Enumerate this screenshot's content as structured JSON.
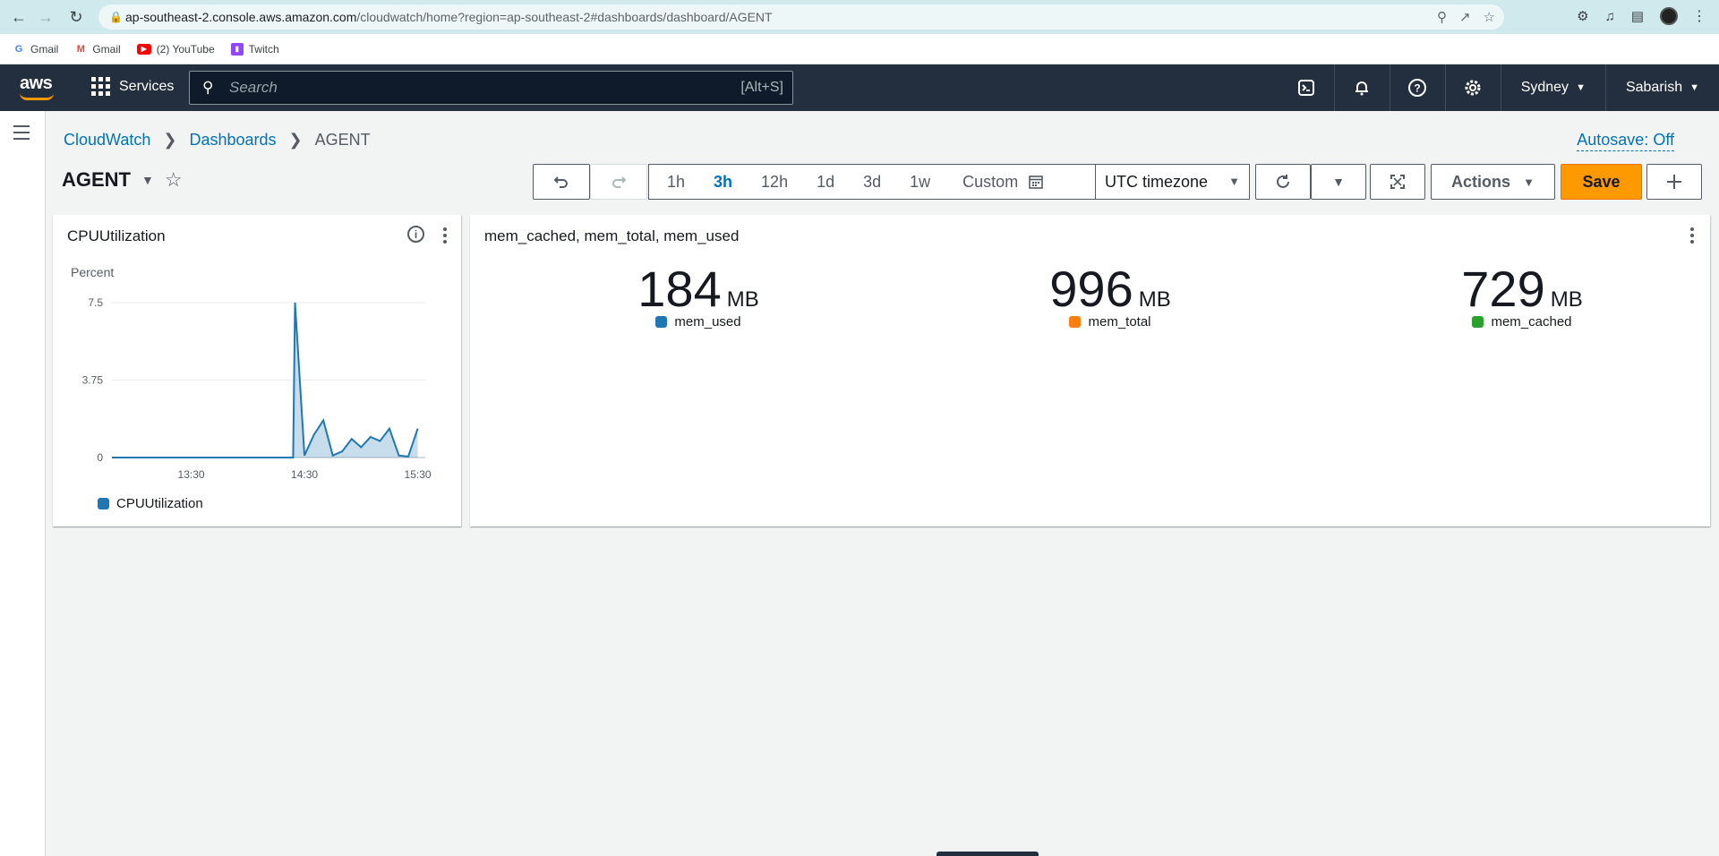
{
  "browser": {
    "url_host": "ap-southeast-2.console.aws.amazon.com",
    "url_path": "/cloudwatch/home?region=ap-southeast-2#dashboards/dashboard/AGENT",
    "bookmarks": [
      {
        "label": "Gmail",
        "icon": "google-icon"
      },
      {
        "label": "Gmail",
        "icon": "gmail-icon"
      },
      {
        "label": "(2) YouTube",
        "icon": "youtube-icon"
      },
      {
        "label": "Twitch",
        "icon": "twitch-icon"
      }
    ]
  },
  "aws_nav": {
    "logo": "aws",
    "services_label": "Services",
    "search_placeholder": "Search",
    "search_hotkey": "[Alt+S]",
    "region": "Sydney",
    "user": "Sabarish"
  },
  "breadcrumb": {
    "items": [
      "CloudWatch",
      "Dashboards"
    ],
    "current": "AGENT"
  },
  "autosave_label": "Autosave: Off",
  "dashboard": {
    "title": "AGENT"
  },
  "toolbar": {
    "ranges": [
      "1h",
      "3h",
      "12h",
      "1d",
      "3d",
      "1w"
    ],
    "active_range": "3h",
    "custom_label": "Custom",
    "timezone": "UTC timezone",
    "actions_label": "Actions",
    "save_label": "Save"
  },
  "widgets": {
    "cpu": {
      "title": "CPUUtilization",
      "unit_label": "Percent",
      "legend": "CPUUtilization",
      "color": "#1f77b4"
    },
    "mem": {
      "title": "mem_cached, mem_total, mem_used",
      "values": [
        {
          "value": "184",
          "unit": "MB",
          "label": "mem_used",
          "color": "#1f77b4"
        },
        {
          "value": "996",
          "unit": "MB",
          "label": "mem_total",
          "color": "#ff7f0e"
        },
        {
          "value": "729",
          "unit": "MB",
          "label": "mem_cached",
          "color": "#2ca02c"
        }
      ]
    }
  },
  "chart_data": {
    "type": "area",
    "title": "CPUUtilization",
    "ylabel": "Percent",
    "ylim": [
      0,
      7.5
    ],
    "yticks": [
      "7.5",
      "3.75",
      "0"
    ],
    "xticks": [
      "13:30",
      "14:30",
      "15:30"
    ],
    "x_range_minutes": [
      12.8,
      15.5
    ],
    "series": [
      {
        "name": "CPUUtilization",
        "color": "#1f77b4",
        "x": [
          "12:48",
          "13:30",
          "14:00",
          "14:24",
          "14:25",
          "14:30",
          "14:35",
          "14:40",
          "14:45",
          "14:50",
          "14:55",
          "15:00",
          "15:05",
          "15:10",
          "15:15",
          "15:20",
          "15:25",
          "15:30"
        ],
        "values": [
          0,
          0,
          0,
          0,
          7.5,
          0.1,
          1.1,
          1.8,
          0.1,
          0.3,
          0.9,
          0.5,
          1.0,
          0.8,
          1.4,
          0.1,
          0.05,
          1.4
        ]
      }
    ],
    "legend": "bottom-left",
    "grid": true
  }
}
